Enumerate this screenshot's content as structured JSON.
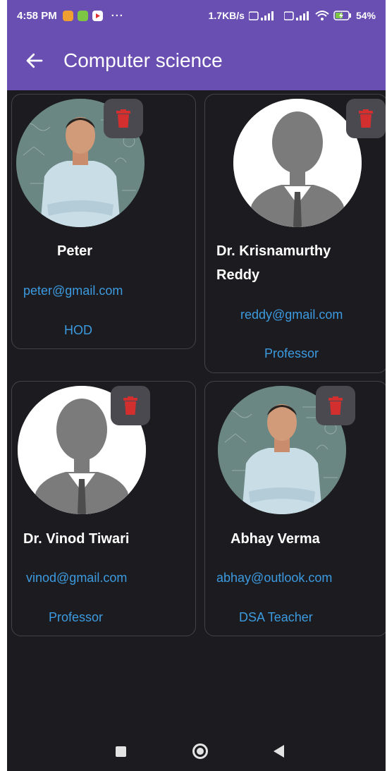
{
  "status_bar": {
    "time": "4:58 PM",
    "dots": "···",
    "net_speed": "1.7KB/s",
    "battery": "54%"
  },
  "app_bar": {
    "title": "Computer science",
    "back_icon": "arrow-left-icon"
  },
  "colors": {
    "accent": "#6a4fb3",
    "background": "#1c1b1f",
    "link": "#3c9be0",
    "delete": "#d32f2f"
  },
  "faculty": [
    {
      "name": "Peter",
      "email": "peter@gmail.com",
      "role": "HOD",
      "photo": "photo"
    },
    {
      "name": "Dr. Krisnamurthy Reddy",
      "email": "reddy@gmail.com",
      "role": "Professor",
      "photo": "placeholder"
    },
    {
      "name": "Dr. Vinod Tiwari",
      "email": "vinod@gmail.com",
      "role": "Professor",
      "photo": "placeholder"
    },
    {
      "name": "Abhay Verma",
      "email": "abhay@outlook.com",
      "role": "DSA Teacher",
      "photo": "photo"
    }
  ]
}
